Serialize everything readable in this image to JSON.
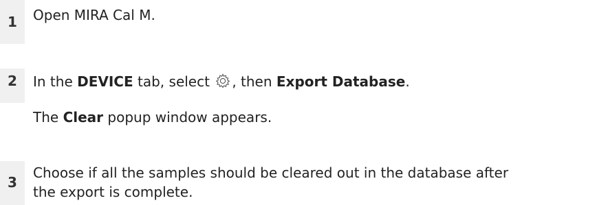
{
  "steps": [
    {
      "number": "1",
      "text": "Open MIRA Cal M."
    },
    {
      "number": "2",
      "text_before": "In the ",
      "bold_tab": "DEVICE",
      "text_mid": " tab, select ",
      "icon": "gear-icon",
      "text_after": ", then ",
      "bold_action": "Export Database",
      "text_end": ".",
      "result_bold": "Clear",
      "result_text": " popup window appears.",
      "result_prefix": "The "
    },
    {
      "number": "3",
      "line1": "Choose if all the samples should be cleared out in the database after",
      "line2": "the export is complete."
    }
  ]
}
